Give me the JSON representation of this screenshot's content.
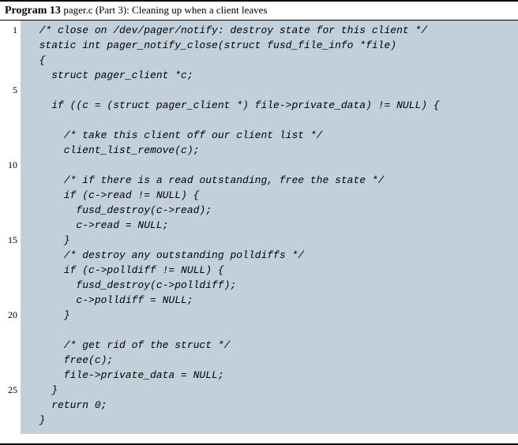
{
  "header": {
    "program_label": "Program 13",
    "filename": "pager.c (Part 3)",
    "caption": ": Cleaning up when a client leaves"
  },
  "gutter_numbers": [
    "1",
    "",
    "",
    "",
    "5",
    "",
    "",
    "",
    "",
    "10",
    "",
    "",
    "",
    "",
    "15",
    "",
    "",
    "",
    "",
    "20",
    "",
    "",
    "",
    "",
    "25",
    "",
    ""
  ],
  "code_lines": [
    "  /* close on /dev/pager/notify: destroy state for this client */",
    "  static int pager_notify_close(struct fusd_file_info *file)",
    "  {",
    "    struct pager_client *c;",
    "",
    "    if ((c = (struct pager_client *) file->private_data) != NULL) {",
    "",
    "      /* take this client off our client list */",
    "      client_list_remove(c);",
    "",
    "      /* if there is a read outstanding, free the state */",
    "      if (c->read != NULL) {",
    "        fusd_destroy(c->read);",
    "        c->read = NULL;",
    "      }",
    "      /* destroy any outstanding polldiffs */",
    "      if (c->polldiff != NULL) {",
    "        fusd_destroy(c->polldiff);",
    "        c->polldiff = NULL;",
    "      }",
    "",
    "      /* get rid of the struct */",
    "      free(c);",
    "      file->private_data = NULL;",
    "    }",
    "    return 0;",
    "  }"
  ]
}
